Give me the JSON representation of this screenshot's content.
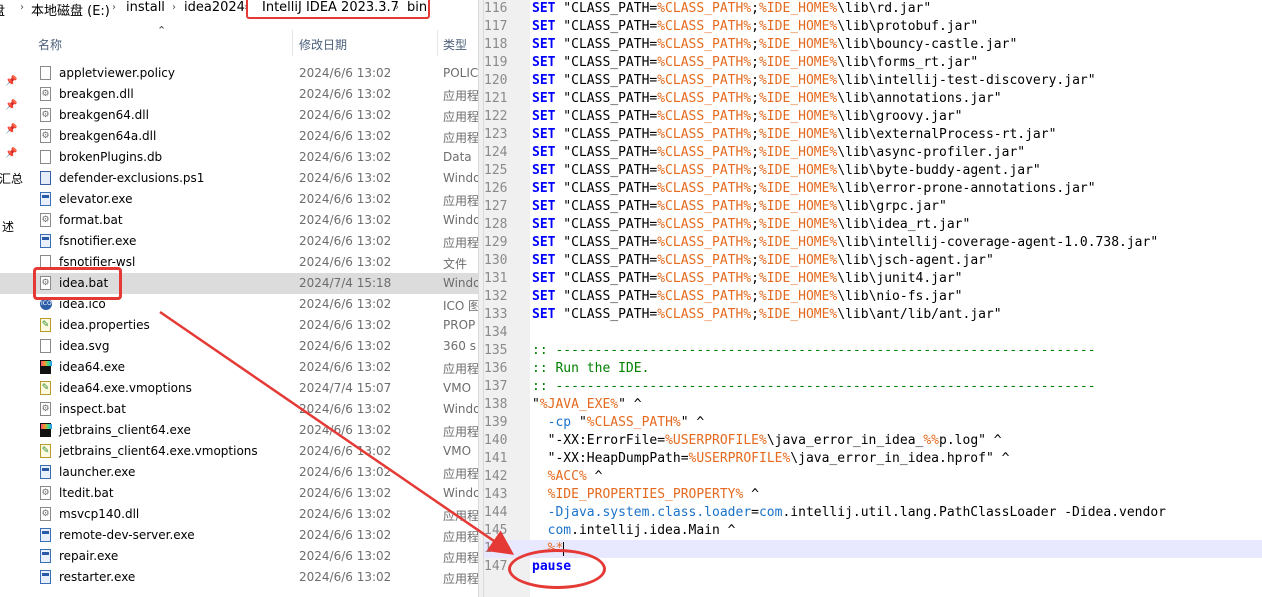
{
  "breadcrumb": {
    "parts": [
      "盘",
      "本地磁盘 (E:)",
      "install",
      "idea2024",
      "IntelliJ IDEA 2023.3.7",
      "bin"
    ]
  },
  "columns": {
    "name": "名称",
    "date": "修改日期",
    "type": "类型"
  },
  "left_rail": {
    "text1": "汇总",
    "text2": "述"
  },
  "files": [
    {
      "name": "appletviewer.policy",
      "date": "2024/6/6 13:02",
      "type": "POLIC",
      "icon": "file-icon"
    },
    {
      "name": "breakgen.dll",
      "date": "2024/6/6 13:02",
      "type": "应用程",
      "icon": "dll-icon"
    },
    {
      "name": "breakgen64.dll",
      "date": "2024/6/6 13:02",
      "type": "应用程",
      "icon": "dll-icon"
    },
    {
      "name": "breakgen64a.dll",
      "date": "2024/6/6 13:02",
      "type": "应用程",
      "icon": "dll-icon"
    },
    {
      "name": "brokenPlugins.db",
      "date": "2024/6/6 13:02",
      "type": "Data",
      "icon": "file-icon"
    },
    {
      "name": "defender-exclusions.ps1",
      "date": "2024/6/6 13:02",
      "type": "Windo",
      "icon": "powershell-icon"
    },
    {
      "name": "elevator.exe",
      "date": "2024/6/6 13:02",
      "type": "应用程",
      "icon": "exe-icon"
    },
    {
      "name": "format.bat",
      "date": "2024/6/6 13:02",
      "type": "Windo",
      "icon": "bat-icon"
    },
    {
      "name": "fsnotifier.exe",
      "date": "2024/6/6 13:02",
      "type": "应用程",
      "icon": "exe-icon"
    },
    {
      "name": "fsnotifier-wsl",
      "date": "2024/6/6 13:02",
      "type": "文件",
      "icon": "file-icon"
    },
    {
      "name": "idea.bat",
      "date": "2024/7/4 15:18",
      "type": "Windo",
      "icon": "bat-icon"
    },
    {
      "name": "idea.ico",
      "date": "2024/6/6 13:02",
      "type": "ICO 图",
      "icon": "ico-icon"
    },
    {
      "name": "idea.properties",
      "date": "2024/6/6 13:02",
      "type": "PROP",
      "icon": "properties-icon"
    },
    {
      "name": "idea.svg",
      "date": "2024/6/6 13:02",
      "type": "360 s",
      "icon": "file-icon"
    },
    {
      "name": "idea64.exe",
      "date": "2024/6/6 13:02",
      "type": "应用程",
      "icon": "intellij-icon"
    },
    {
      "name": "idea64.exe.vmoptions",
      "date": "2024/7/4 15:07",
      "type": "VMO",
      "icon": "properties-icon"
    },
    {
      "name": "inspect.bat",
      "date": "2024/6/6 13:02",
      "type": "Windo",
      "icon": "bat-icon"
    },
    {
      "name": "jetbrains_client64.exe",
      "date": "2024/6/6 13:02",
      "type": "应用程",
      "icon": "intellij-icon"
    },
    {
      "name": "jetbrains_client64.exe.vmoptions",
      "date": "2024/6/6 13:02",
      "type": "VMO",
      "icon": "properties-icon"
    },
    {
      "name": "launcher.exe",
      "date": "2024/6/6 13:02",
      "type": "应用程",
      "icon": "exe-icon"
    },
    {
      "name": "ltedit.bat",
      "date": "2024/6/6 13:02",
      "type": "Windo",
      "icon": "bat-icon"
    },
    {
      "name": "msvcp140.dll",
      "date": "2024/6/6 13:02",
      "type": "应用程",
      "icon": "dll-icon"
    },
    {
      "name": "remote-dev-server.exe",
      "date": "2024/6/6 13:02",
      "type": "应用程",
      "icon": "exe-icon"
    },
    {
      "name": "repair.exe",
      "date": "2024/6/6 13:02",
      "type": "应用程",
      "icon": "exe-icon"
    },
    {
      "name": "restarter.exe",
      "date": "2024/6/6 13:02",
      "type": "应用程",
      "icon": "exe-icon"
    }
  ],
  "editor": {
    "lines": [
      {
        "n": "116",
        "seg": [
          [
            "kw",
            "SET"
          ],
          [
            "str",
            " \"CLASS_PATH="
          ],
          [
            "var",
            "%CLASS_PATH%"
          ],
          [
            "str",
            ";"
          ],
          [
            "var",
            "%IDE_HOME%"
          ],
          [
            "str",
            "\\lib\\rd.jar\""
          ]
        ]
      },
      {
        "n": "117",
        "seg": [
          [
            "kw",
            "SET"
          ],
          [
            "str",
            " \"CLASS_PATH="
          ],
          [
            "var",
            "%CLASS_PATH%"
          ],
          [
            "str",
            ";"
          ],
          [
            "var",
            "%IDE_HOME%"
          ],
          [
            "str",
            "\\lib\\protobuf.jar\""
          ]
        ]
      },
      {
        "n": "118",
        "seg": [
          [
            "kw",
            "SET"
          ],
          [
            "str",
            " \"CLASS_PATH="
          ],
          [
            "var",
            "%CLASS_PATH%"
          ],
          [
            "str",
            ";"
          ],
          [
            "var",
            "%IDE_HOME%"
          ],
          [
            "str",
            "\\lib\\bouncy-castle.jar\""
          ]
        ]
      },
      {
        "n": "119",
        "seg": [
          [
            "kw",
            "SET"
          ],
          [
            "str",
            " \"CLASS_PATH="
          ],
          [
            "var",
            "%CLASS_PATH%"
          ],
          [
            "str",
            ";"
          ],
          [
            "var",
            "%IDE_HOME%"
          ],
          [
            "str",
            "\\lib\\forms_rt.jar\""
          ]
        ]
      },
      {
        "n": "120",
        "seg": [
          [
            "kw",
            "SET"
          ],
          [
            "str",
            " \"CLASS_PATH="
          ],
          [
            "var",
            "%CLASS_PATH%"
          ],
          [
            "str",
            ";"
          ],
          [
            "var",
            "%IDE_HOME%"
          ],
          [
            "str",
            "\\lib\\intellij-test-discovery.jar\""
          ]
        ]
      },
      {
        "n": "121",
        "seg": [
          [
            "kw",
            "SET"
          ],
          [
            "str",
            " \"CLASS_PATH="
          ],
          [
            "var",
            "%CLASS_PATH%"
          ],
          [
            "str",
            ";"
          ],
          [
            "var",
            "%IDE_HOME%"
          ],
          [
            "str",
            "\\lib\\annotations.jar\""
          ]
        ]
      },
      {
        "n": "122",
        "seg": [
          [
            "kw",
            "SET"
          ],
          [
            "str",
            " \"CLASS_PATH="
          ],
          [
            "var",
            "%CLASS_PATH%"
          ],
          [
            "str",
            ";"
          ],
          [
            "var",
            "%IDE_HOME%"
          ],
          [
            "str",
            "\\lib\\groovy.jar\""
          ]
        ]
      },
      {
        "n": "123",
        "seg": [
          [
            "kw",
            "SET"
          ],
          [
            "str",
            " \"CLASS_PATH="
          ],
          [
            "var",
            "%CLASS_PATH%"
          ],
          [
            "str",
            ";"
          ],
          [
            "var",
            "%IDE_HOME%"
          ],
          [
            "str",
            "\\lib\\externalProcess-rt.jar\""
          ]
        ]
      },
      {
        "n": "124",
        "seg": [
          [
            "kw",
            "SET"
          ],
          [
            "str",
            " \"CLASS_PATH="
          ],
          [
            "var",
            "%CLASS_PATH%"
          ],
          [
            "str",
            ";"
          ],
          [
            "var",
            "%IDE_HOME%"
          ],
          [
            "str",
            "\\lib\\async-profiler.jar\""
          ]
        ]
      },
      {
        "n": "125",
        "seg": [
          [
            "kw",
            "SET"
          ],
          [
            "str",
            " \"CLASS_PATH="
          ],
          [
            "var",
            "%CLASS_PATH%"
          ],
          [
            "str",
            ";"
          ],
          [
            "var",
            "%IDE_HOME%"
          ],
          [
            "str",
            "\\lib\\byte-buddy-agent.jar\""
          ]
        ]
      },
      {
        "n": "126",
        "seg": [
          [
            "kw",
            "SET"
          ],
          [
            "str",
            " \"CLASS_PATH="
          ],
          [
            "var",
            "%CLASS_PATH%"
          ],
          [
            "str",
            ";"
          ],
          [
            "var",
            "%IDE_HOME%"
          ],
          [
            "str",
            "\\lib\\error-prone-annotations.jar\""
          ]
        ]
      },
      {
        "n": "127",
        "seg": [
          [
            "kw",
            "SET"
          ],
          [
            "str",
            " \"CLASS_PATH="
          ],
          [
            "var",
            "%CLASS_PATH%"
          ],
          [
            "str",
            ";"
          ],
          [
            "var",
            "%IDE_HOME%"
          ],
          [
            "str",
            "\\lib\\grpc.jar\""
          ]
        ]
      },
      {
        "n": "128",
        "seg": [
          [
            "kw",
            "SET"
          ],
          [
            "str",
            " \"CLASS_PATH="
          ],
          [
            "var",
            "%CLASS_PATH%"
          ],
          [
            "str",
            ";"
          ],
          [
            "var",
            "%IDE_HOME%"
          ],
          [
            "str",
            "\\lib\\idea_rt.jar\""
          ]
        ]
      },
      {
        "n": "129",
        "seg": [
          [
            "kw",
            "SET"
          ],
          [
            "str",
            " \"CLASS_PATH="
          ],
          [
            "var",
            "%CLASS_PATH%"
          ],
          [
            "str",
            ";"
          ],
          [
            "var",
            "%IDE_HOME%"
          ],
          [
            "str",
            "\\lib\\intellij-coverage-agent-1.0.738.jar\""
          ]
        ]
      },
      {
        "n": "130",
        "seg": [
          [
            "kw",
            "SET"
          ],
          [
            "str",
            " \"CLASS_PATH="
          ],
          [
            "var",
            "%CLASS_PATH%"
          ],
          [
            "str",
            ";"
          ],
          [
            "var",
            "%IDE_HOME%"
          ],
          [
            "str",
            "\\lib\\jsch-agent.jar\""
          ]
        ]
      },
      {
        "n": "131",
        "seg": [
          [
            "kw",
            "SET"
          ],
          [
            "str",
            " \"CLASS_PATH="
          ],
          [
            "var",
            "%CLASS_PATH%"
          ],
          [
            "str",
            ";"
          ],
          [
            "var",
            "%IDE_HOME%"
          ],
          [
            "str",
            "\\lib\\junit4.jar\""
          ]
        ]
      },
      {
        "n": "132",
        "seg": [
          [
            "kw",
            "SET"
          ],
          [
            "str",
            " \"CLASS_PATH="
          ],
          [
            "var",
            "%CLASS_PATH%"
          ],
          [
            "str",
            ";"
          ],
          [
            "var",
            "%IDE_HOME%"
          ],
          [
            "str",
            "\\lib\\nio-fs.jar\""
          ]
        ]
      },
      {
        "n": "133",
        "seg": [
          [
            "kw",
            "SET"
          ],
          [
            "str",
            " \"CLASS_PATH="
          ],
          [
            "var",
            "%CLASS_PATH%"
          ],
          [
            "str",
            ";"
          ],
          [
            "var",
            "%IDE_HOME%"
          ],
          [
            "str",
            "\\lib\\ant/lib/ant.jar\""
          ]
        ]
      },
      {
        "n": "134",
        "seg": []
      },
      {
        "n": "135",
        "seg": [
          [
            "cmt",
            ":: ---------------------------------------------------------------------"
          ]
        ]
      },
      {
        "n": "136",
        "seg": [
          [
            "cmt",
            ":: Run the IDE."
          ]
        ]
      },
      {
        "n": "137",
        "seg": [
          [
            "cmt",
            ":: ---------------------------------------------------------------------"
          ]
        ]
      },
      {
        "n": "138",
        "seg": [
          [
            "str",
            "\""
          ],
          [
            "var",
            "%JAVA_EXE%"
          ],
          [
            "str",
            "\" ^"
          ]
        ]
      },
      {
        "n": "139",
        "seg": [
          [
            "opt",
            "  -cp"
          ],
          [
            "str",
            " \""
          ],
          [
            "var",
            "%CLASS_PATH%"
          ],
          [
            "str",
            "\" ^"
          ]
        ]
      },
      {
        "n": "140",
        "seg": [
          [
            "str",
            "  \"-XX:ErrorFile="
          ],
          [
            "var",
            "%USERPROFILE%"
          ],
          [
            "str",
            "\\java_error_in_idea_"
          ],
          [
            "var",
            "%%"
          ],
          [
            "str",
            "p.log\" ^"
          ]
        ]
      },
      {
        "n": "141",
        "seg": [
          [
            "str",
            "  \"-XX:HeapDumpPath="
          ],
          [
            "var",
            "%USERPROFILE%"
          ],
          [
            "str",
            "\\java_error_in_idea.hprof\" ^"
          ]
        ]
      },
      {
        "n": "142",
        "seg": [
          [
            "var",
            "  %ACC%"
          ],
          [
            "str",
            " ^"
          ]
        ]
      },
      {
        "n": "143",
        "seg": [
          [
            "var",
            "  %IDE_PROPERTIES_PROPERTY%"
          ],
          [
            "str",
            " ^"
          ]
        ]
      },
      {
        "n": "144",
        "seg": [
          [
            "opt",
            "  -Djava.system.class.loader"
          ],
          [
            "str",
            "="
          ],
          [
            "opt",
            "com"
          ],
          [
            "str",
            ".intellij.util.lang.PathClassLoader -Didea.vendor"
          ]
        ]
      },
      {
        "n": "145",
        "seg": [
          [
            "opt",
            "  com"
          ],
          [
            "str",
            ".intellij.idea.Main ^"
          ]
        ]
      },
      {
        "n": "146",
        "seg": [
          [
            "var",
            "  %*"
          ]
        ],
        "current": true
      },
      {
        "n": "147",
        "seg": [
          [
            "kw",
            "pause"
          ]
        ]
      }
    ]
  },
  "colors": {
    "annotation_red": "#e53935",
    "keyword_blue": "#0000ff",
    "variable_orange": "#e56a1f",
    "comment_green": "#008000"
  }
}
